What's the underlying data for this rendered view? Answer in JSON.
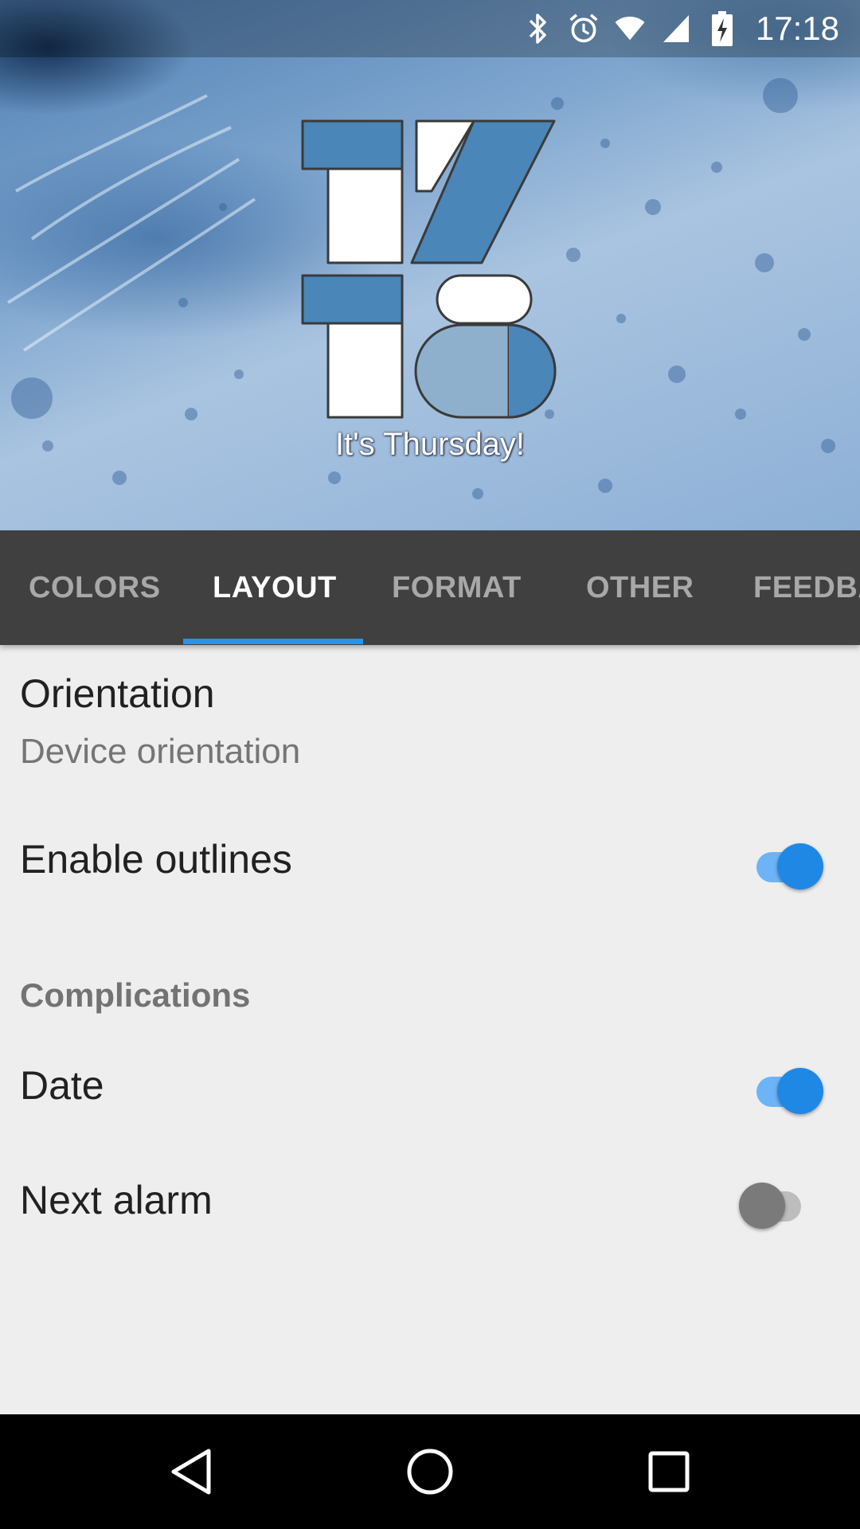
{
  "status_bar": {
    "time": "17:18",
    "icons": [
      "bluetooth-icon",
      "alarm-clock-icon",
      "wifi-icon",
      "cell-signal-icon",
      "battery-charging-icon"
    ]
  },
  "preview": {
    "clock_hours": "17",
    "clock_minutes": "18",
    "caption": "It's Thursday!",
    "colors": {
      "primary": "#4a86b8",
      "secondary": "#ffffff",
      "light": "#8fb0cc",
      "outline": "#3a3a3a"
    }
  },
  "tabs": {
    "items": [
      {
        "label": "COLORS",
        "active": false
      },
      {
        "label": "LAYOUT",
        "active": true
      },
      {
        "label": "FORMAT",
        "active": false
      },
      {
        "label": "OTHER",
        "active": false
      },
      {
        "label": "FEEDBA",
        "active": false
      }
    ],
    "indicator_color": "#2a93e8"
  },
  "settings": {
    "orientation": {
      "title": "Orientation",
      "subtitle": "Device orientation"
    },
    "enable_outlines": {
      "title": "Enable outlines",
      "enabled": true
    },
    "complications_header": "Complications",
    "date": {
      "title": "Date",
      "enabled": true
    },
    "next_alarm": {
      "title": "Next alarm",
      "enabled": false
    }
  },
  "nav_bar": {
    "icons": [
      "back-icon",
      "home-icon",
      "recents-icon"
    ]
  }
}
